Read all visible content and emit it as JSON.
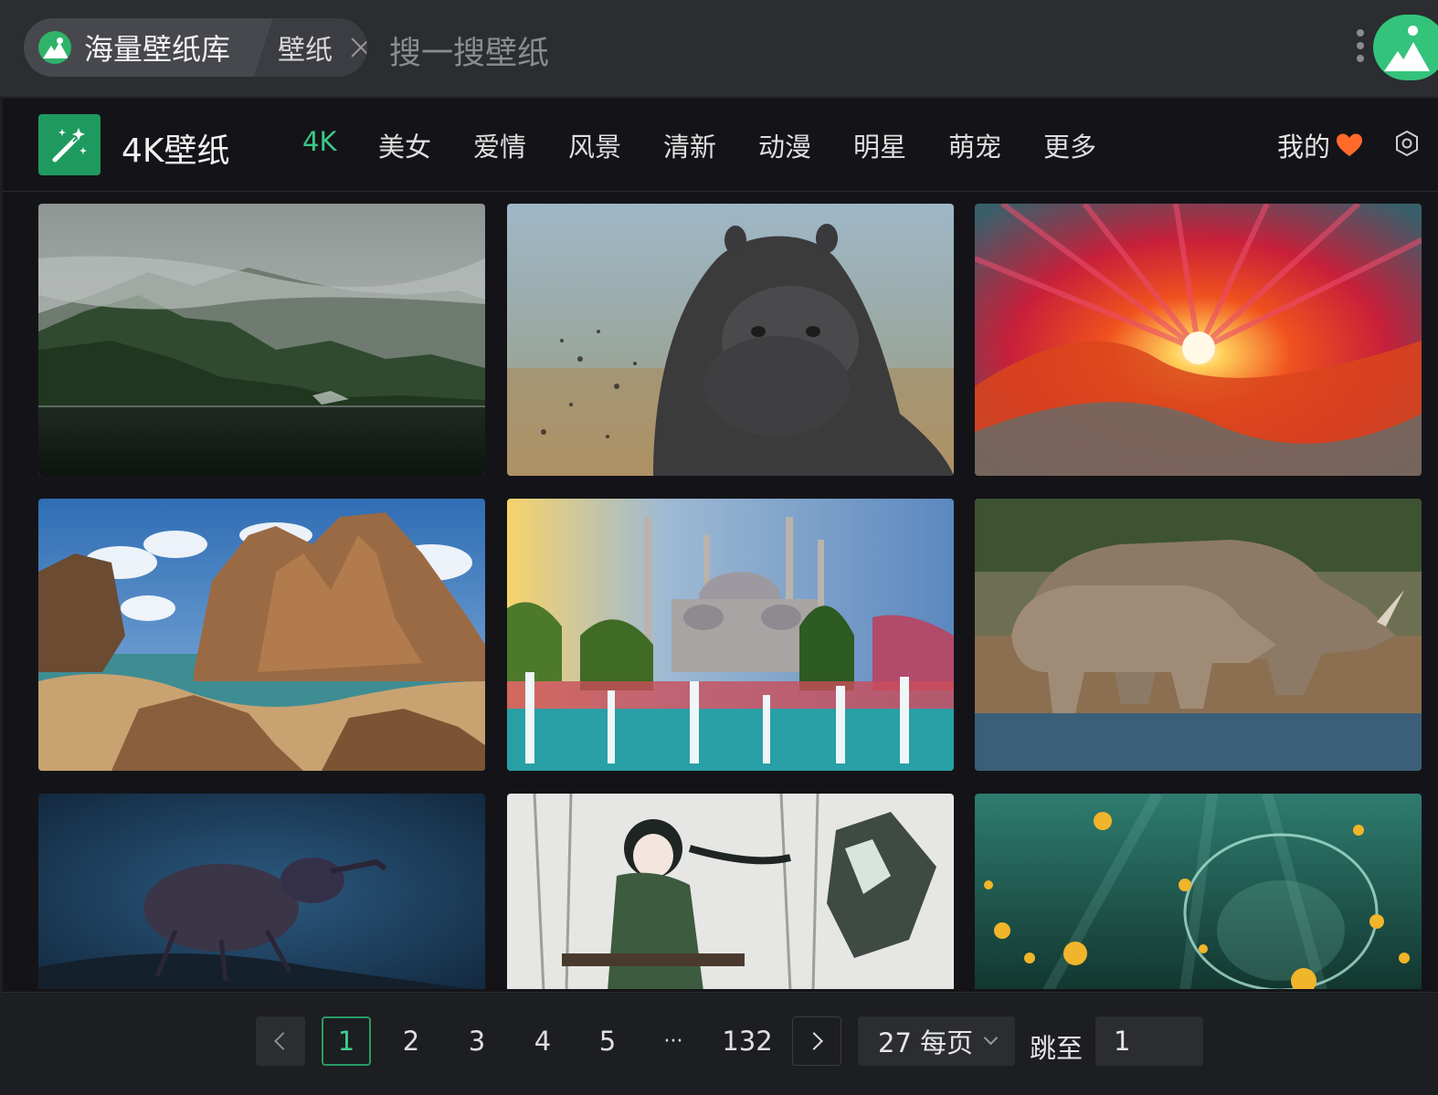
{
  "topbar": {
    "app_name": "海量壁纸库",
    "tab_label": "壁纸",
    "search_placeholder": "搜一搜壁纸"
  },
  "navbar": {
    "brand_title": "4K壁纸",
    "items": [
      {
        "label": "4K",
        "active": true
      },
      {
        "label": "美女",
        "active": false
      },
      {
        "label": "爱情",
        "active": false
      },
      {
        "label": "风景",
        "active": false
      },
      {
        "label": "清新",
        "active": false
      },
      {
        "label": "动漫",
        "active": false
      },
      {
        "label": "明星",
        "active": false
      },
      {
        "label": "萌宠",
        "active": false
      },
      {
        "label": "更多",
        "active": false
      }
    ],
    "mine_label": "我的"
  },
  "gallery": {
    "items": [
      {
        "subject": "misty mountain lake"
      },
      {
        "subject": "hippopotamus"
      },
      {
        "subject": "abstract red fractal sunset"
      },
      {
        "subject": "coastal rock formations"
      },
      {
        "subject": "mosque with fountains"
      },
      {
        "subject": "rhinoceros mother and calf"
      },
      {
        "subject": "weevil beetle macro"
      },
      {
        "subject": "anime girl in forest"
      },
      {
        "subject": "jellyfish underwater"
      }
    ]
  },
  "pagination": {
    "pages": [
      "1",
      "2",
      "3",
      "4",
      "5",
      "···",
      "132"
    ],
    "current_page": "1",
    "page_size": "27 每页",
    "jump_label": "跳至",
    "jump_value": "1"
  },
  "colors": {
    "accent": "#39c98a",
    "brand_green": "#1f9a5f",
    "heart": "#ff6a2b"
  }
}
